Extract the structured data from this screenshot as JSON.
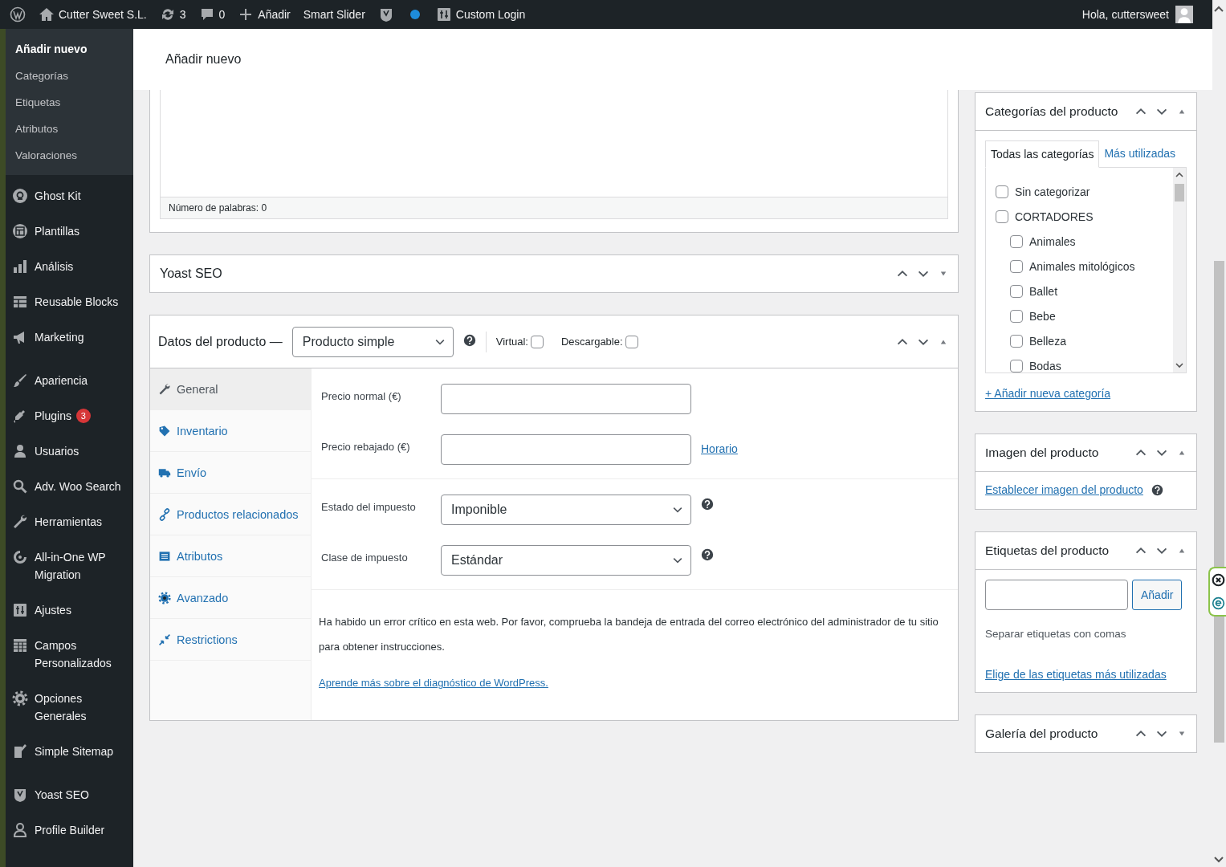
{
  "admin_bar": {
    "items": [
      {
        "kind": "logo"
      },
      {
        "kind": "home",
        "label": "Cutter Sweet S.L."
      },
      {
        "kind": "updates",
        "label": "3"
      },
      {
        "kind": "comments",
        "label": "0"
      },
      {
        "kind": "new",
        "label": "Añadir"
      },
      {
        "kind": "text",
        "label": "Smart Slider"
      },
      {
        "kind": "shield"
      },
      {
        "kind": "dot"
      },
      {
        "kind": "login",
        "label": "Custom Login"
      }
    ],
    "greeting": "Hola, cuttersweet"
  },
  "sidebar": {
    "submenu": [
      {
        "label": "Añadir nuevo",
        "selected": true
      },
      {
        "label": "Categorías",
        "selected": false
      },
      {
        "label": "Etiquetas",
        "selected": false
      },
      {
        "label": "Atributos",
        "selected": false
      },
      {
        "label": "Valoraciones",
        "selected": false
      }
    ],
    "menu_groups": [
      [
        {
          "kind": "ghost",
          "label": "Ghost Kit"
        },
        {
          "kind": "layout",
          "label": "Plantillas"
        },
        {
          "kind": "bars",
          "label": "Análisis"
        },
        {
          "kind": "grid",
          "label": "Reusable Blocks"
        },
        {
          "kind": "megaphone",
          "label": "Marketing"
        }
      ],
      [
        {
          "kind": "brush",
          "label": "Apariencia"
        },
        {
          "kind": "plug",
          "label": "Plugins",
          "badge": "3"
        },
        {
          "kind": "person",
          "label": "Usuarios"
        },
        {
          "kind": "search",
          "label": "Adv. Woo Search"
        },
        {
          "kind": "wrench",
          "label": "Herramientas"
        },
        {
          "kind": "cycle",
          "label": "All-in-One WP Migration"
        },
        {
          "kind": "sliders",
          "label": "Ajustes"
        },
        {
          "kind": "table",
          "label": "Campos Personalizados"
        },
        {
          "kind": "gear",
          "label": "Opciones Generales"
        },
        {
          "kind": "page",
          "label": "Simple Sitemap"
        }
      ],
      [
        {
          "kind": "shield",
          "label": "Yoast SEO"
        },
        {
          "kind": "person-outline",
          "label": "Profile Builder"
        }
      ]
    ]
  },
  "page_header": {
    "title": "Añadir nuevo"
  },
  "editor": {
    "word_count": "Número de palabras: 0"
  },
  "yoast_box": {
    "title": "Yoast SEO",
    "collapsed": true
  },
  "product_data": {
    "title": "Datos del producto —",
    "product_type": "Producto simple",
    "collapsed": false,
    "options": [
      {
        "label": "Virtual:",
        "checked": false
      },
      {
        "label": "Descargable:",
        "checked": false
      }
    ],
    "tabs": [
      {
        "kind": "wrench",
        "label": "General",
        "selected": true
      },
      {
        "kind": "tag",
        "label": "Inventario",
        "selected": false
      },
      {
        "kind": "truck",
        "label": "Envío",
        "selected": false
      },
      {
        "kind": "link",
        "label": "Productos relacionados",
        "selected": false
      },
      {
        "kind": "list",
        "label": "Atributos",
        "selected": false
      },
      {
        "kind": "gear",
        "label": "Avanzado",
        "selected": false
      },
      {
        "kind": "arrows",
        "label": "Restrictions",
        "selected": false
      }
    ],
    "field_groups": [
      [
        {
          "kind": "input",
          "label": "Precio normal (€)"
        },
        {
          "kind": "input",
          "label": "Precio rebajado (€)",
          "link": "Horario"
        }
      ],
      [
        {
          "kind": "select",
          "label": "Estado del impuesto",
          "value": "Imponible",
          "help": true
        },
        {
          "kind": "select",
          "label": "Clase de impuesto",
          "value": "Estándar",
          "help": true
        }
      ]
    ],
    "error_message": "Ha habido un error crítico en esta web. Por favor, comprueba la bandeja de entrada del correo electrónico del administrador de tu sitio para obtener instrucciones.",
    "error_link": "Aprende más sobre el diagnóstico de WordPress."
  },
  "categories_box": {
    "title": "Categorías del producto",
    "collapsed": false,
    "tabs": [
      {
        "label": "Todas las categorías",
        "selected": true
      },
      {
        "label": "Más utilizadas",
        "selected": false
      }
    ],
    "categories": [
      {
        "label": "Sin categorizar",
        "checked": false
      },
      {
        "label": "CORTADORES",
        "checked": false,
        "children": [
          {
            "label": "Animales",
            "checked": false
          },
          {
            "label": "Animales mitológicos",
            "checked": false
          },
          {
            "label": "Ballet",
            "checked": false
          },
          {
            "label": "Bebe",
            "checked": false
          },
          {
            "label": "Belleza",
            "checked": false
          },
          {
            "label": "Bodas",
            "checked": false
          }
        ]
      }
    ],
    "add_link": "+ Añadir nueva categoría"
  },
  "image_box": {
    "title": "Imagen del producto",
    "collapsed": false,
    "link": "Establecer imagen del producto"
  },
  "tags_box": {
    "title": "Etiquetas del producto",
    "collapsed": false,
    "button": "Añadir",
    "hint": "Separar etiquetas con comas",
    "link": "Elige de las etiquetas más utilizadas"
  },
  "gallery_box": {
    "title": "Galería del producto",
    "collapsed": true
  }
}
